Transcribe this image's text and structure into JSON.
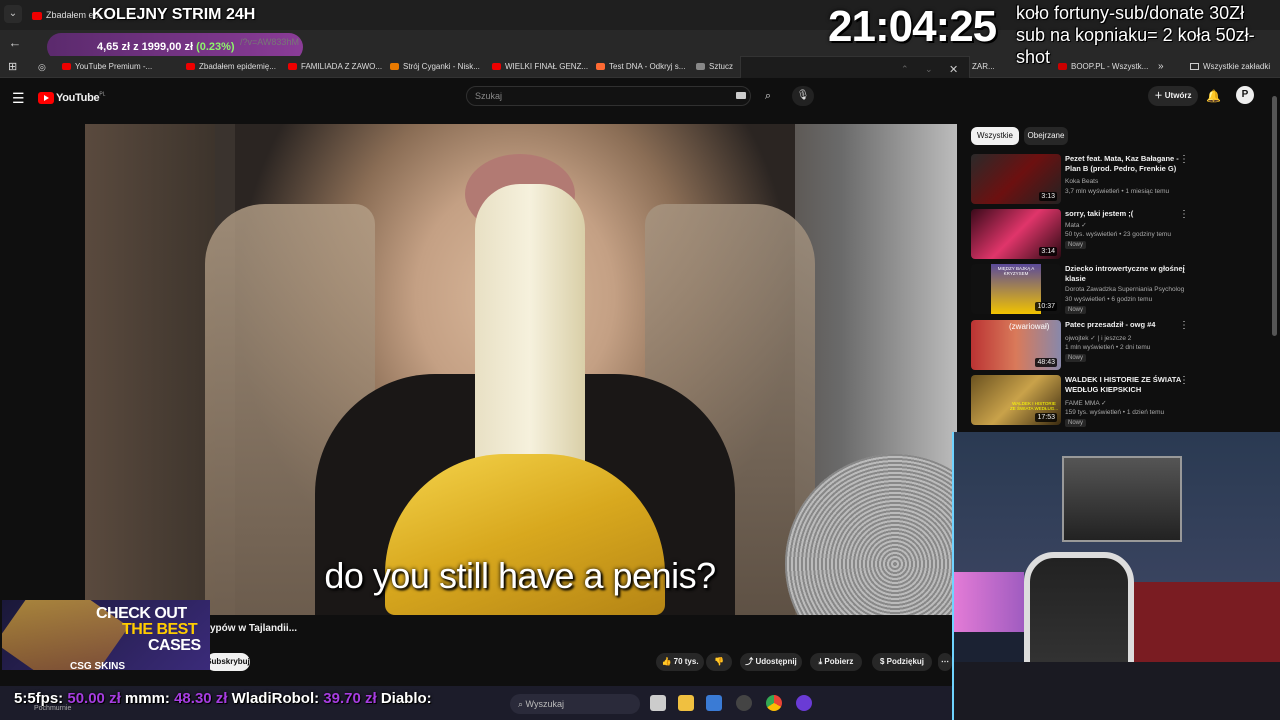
{
  "browser": {
    "active_tab_title": "Zbadałem ep",
    "stream_title": "KOLEJNY STRIM 24H",
    "url_hint": "/?v=AW833hM",
    "price_pill": {
      "main": "4,65 zł z 1999,00 zł",
      "change": "(0.23%)"
    },
    "bookmarks": [
      {
        "label": "YouTube Premium -...",
        "icon": "youtube-icon"
      },
      {
        "label": "Zbadałem epidemię...",
        "icon": "youtube-icon"
      },
      {
        "label": "FAMILIADA Z ZAWO...",
        "icon": "youtube-icon"
      },
      {
        "label": "Strój Cyganki - Nisk...",
        "icon": "shop-icon"
      },
      {
        "label": "WIELKI FINAŁ GENZ...",
        "icon": "youtube-icon"
      },
      {
        "label": "Test DNA - Odkryj s...",
        "icon": "dna-icon"
      },
      {
        "label": "Sztucz",
        "icon": "ai-icon"
      },
      {
        "label": "ZAR...",
        "icon": "page-icon"
      },
      {
        "label": "BOOP.PL - Wszystk...",
        "icon": "page-icon"
      },
      {
        "label": "Wszystkie zakładki",
        "icon": "folder-icon"
      }
    ]
  },
  "youtube": {
    "search_placeholder": "Szukaj",
    "create_label": "Utwórz",
    "avatar_letter": "P",
    "logo_text": "YouTube",
    "logo_region": "PL",
    "chips": [
      "Wszystkie",
      "Obejrzane"
    ],
    "video": {
      "caption": "do you still have a penis?",
      "title_fragment": "ypów w Tajlandii...",
      "subscribe_label": "Subskrybuj",
      "likes": "70 tys.",
      "share_label": "Udostępnij",
      "download_label": "Pobierz",
      "thanks_label": "Podziękuj"
    },
    "recommendations": [
      {
        "title": "Pezet feat. Mata, Kaz Bałagane - Plan B (prod. Pedro, Frenkie G)",
        "channel": "Koka Beats",
        "meta": "3,7 mln wyświetleń • 1 miesiąc temu",
        "duration": "3:13",
        "badge": ""
      },
      {
        "title": "sorry, taki jestem ;(",
        "channel": "Mata",
        "meta": "50 tys. wyświetleń • 23 godziny temu",
        "duration": "3:14",
        "badge": "Nowy"
      },
      {
        "title": "Dziecko introwertyczne w głośnej klasie",
        "channel": "Dorota Zawadzka Superniania Psycholog",
        "meta": "30 wyświetleń • 6 godzin temu",
        "duration": "10:37",
        "badge": "Nowy"
      },
      {
        "title": "Patec przesadził - owg #4",
        "channel": "ojwojtek",
        "meta": "1 mln wyświetleń • 2 dni temu",
        "duration": "48:43",
        "badge": "Nowy",
        "extra": "i jeszcze 2"
      },
      {
        "title": "WALDEK I HISTORIE ZE ŚWIATA WEDŁUG KIEPSKICH",
        "channel": "FAME MMA",
        "meta": "159 tys. wyświetleń • 1 dzień temu",
        "duration": "17:53",
        "badge": "Nowy"
      }
    ],
    "thumb_texts": {
      "t3": "MIĘDZY BAJKĄ A KRYZYSEM",
      "t4": "(zwariował)",
      "t5": "WALDEK I HISTORIE ZE ŚWIATA WEDŁUG..."
    }
  },
  "overlay": {
    "clock": "21:04:25",
    "wheel_text": "koło fortuny-sub/donate 30Zł sub na kopniaku= 2 koła 50zł-shot",
    "ad": {
      "line1": "CHECK OUT",
      "line2": "THE BEST",
      "line3": "CASES",
      "logo": "CSG SKINS"
    },
    "ticker": [
      {
        "name": "5:5fps:",
        "amount": "50.00 zł"
      },
      {
        "name": "mmm:",
        "amount": "48.30 zł"
      },
      {
        "name": "WladiRobol:",
        "amount": "39.70 zł"
      },
      {
        "name": "Diablo:",
        "amount": ""
      }
    ],
    "taskbar_search": "Wyszukaj",
    "taskbar_label": "Pochmurnie"
  }
}
